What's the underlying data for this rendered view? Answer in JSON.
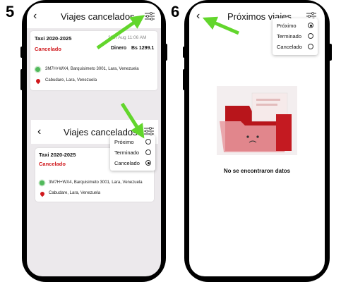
{
  "steps": {
    "left": "5",
    "right": "6"
  },
  "left_screen": {
    "title": "Viajes cancelados",
    "trip": {
      "name": "Taxi 2020-2025",
      "status": "Cancelado",
      "date": "29th Aug 11:06 AM",
      "payment_label": "Dinero",
      "amount": "Bs 1299.1",
      "origin": "3M7H+WX4, Barquisimeto 3001, Lara, Venezuela",
      "destination": "Cabudare, Lara, Venezuela"
    }
  },
  "zoom_panel": {
    "title": "Viajes cancelados",
    "trip": {
      "name": "Taxi 2020-2025",
      "status": "Cancelado",
      "origin": "3M7H+WX4, Barquisimeto 3001, Lara, Venezuela",
      "destination": "Cabudare, Lara, Venezuela"
    },
    "menu": [
      {
        "label": "Próximo",
        "selected": false
      },
      {
        "label": "Terminado",
        "selected": false
      },
      {
        "label": "Cancelado",
        "selected": true
      }
    ]
  },
  "right_screen": {
    "title": "Próximos viajes",
    "menu": [
      {
        "label": "Próximo",
        "selected": true
      },
      {
        "label": "Terminado",
        "selected": false
      },
      {
        "label": "Cancelado",
        "selected": false
      }
    ],
    "empty_message": "No se encontraron datos"
  },
  "colors": {
    "accent_red": "#d0181c",
    "arrow_green": "#62d62c",
    "pin_green": "#51b95b"
  }
}
